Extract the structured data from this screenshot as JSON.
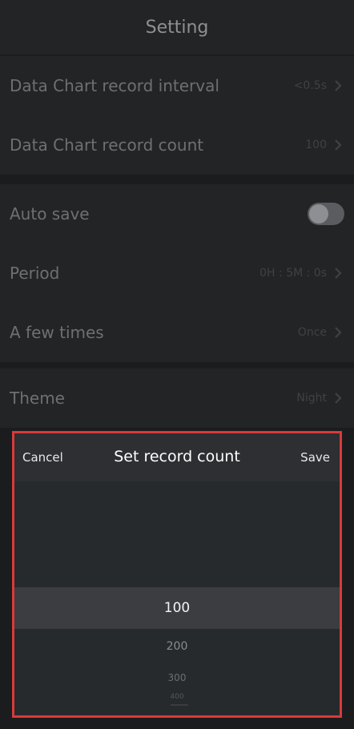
{
  "header": {
    "title": "Setting"
  },
  "groups": [
    {
      "rows": [
        {
          "label": "Data Chart record interval",
          "value": "<0.5s"
        },
        {
          "label": "Data Chart record count",
          "value": "100"
        }
      ]
    },
    {
      "rows": [
        {
          "label": "Auto save",
          "toggle": false
        },
        {
          "label": "Period",
          "value": "0H : 5M : 0s"
        },
        {
          "label": "A few times",
          "value": "Once"
        }
      ]
    },
    {
      "rows": [
        {
          "label": "Theme",
          "value": "Night"
        }
      ]
    }
  ],
  "sheet": {
    "cancel_label": "Cancel",
    "title": "Set record count",
    "save_label": "Save",
    "options": [
      "100",
      "200",
      "300",
      "400"
    ],
    "selected": "100"
  },
  "colors": {
    "background": "#1b1c1e",
    "row_background": "#232426",
    "highlight_border": "#d93a3a",
    "sheet_background": "#2a2c2f"
  }
}
